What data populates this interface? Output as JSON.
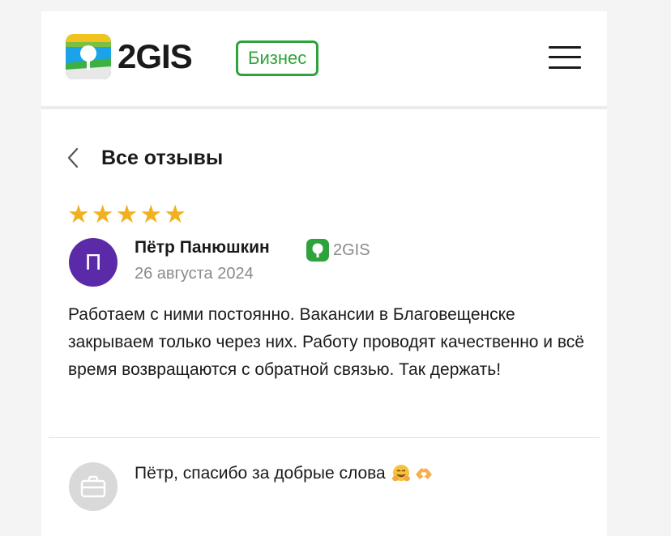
{
  "header": {
    "logo_text": "2GIS",
    "badge_label": "Бизнес",
    "menu_icon": "hamburger-menu-icon"
  },
  "nav": {
    "back_icon": "chevron-left-icon",
    "title": "Все отзывы"
  },
  "review": {
    "rating": 5,
    "stars": [
      "★",
      "★",
      "★",
      "★",
      "★"
    ],
    "avatar_initial": "П",
    "author": "Пётр Панюшкин",
    "source_label": "2GIS",
    "date": "26 августа 2024",
    "text": "Работаем с ними постоянно. Вакансии в Благовещенске закрываем только через них. Работу проводят качественно и всё время возвращаются с обратной связью. Так держать!"
  },
  "reply": {
    "avatar_icon": "briefcase-icon",
    "text": "Пётр, спасибо за добрые слова",
    "emojis": [
      "hugging-face-emoji",
      "heart-hands-emoji"
    ]
  },
  "colors": {
    "accent_green": "#2fa33b",
    "star": "#f2b01e",
    "avatar_purple": "#5b2aa8",
    "muted_text": "#8a8a8a"
  }
}
